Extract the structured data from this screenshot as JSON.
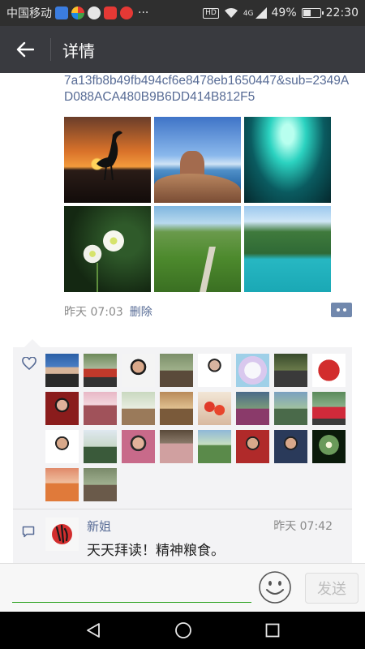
{
  "status_bar": {
    "carrier": "中国移动",
    "more": "···",
    "network": "4G",
    "battery": "49%",
    "battery_level": 0.49,
    "time": "22:30",
    "hd": "HD"
  },
  "app_bar": {
    "title": "详情",
    "back_icon": "arrow-left-icon"
  },
  "post": {
    "link_text": "7a13fb8b49fb494cf6e8478eb1650447&sub=2349AD088ACA480B9B6DD414B812F5",
    "photos": [
      "crane-sunset",
      "rocky-seashore",
      "underwater-cave",
      "white-flowers",
      "green-valley-road",
      "fjord-lake"
    ],
    "time": "昨天 07:03",
    "delete_label": "删除"
  },
  "likes": {
    "icon": "heart-icon",
    "count": 26
  },
  "comment": {
    "icon": "comment-icon",
    "name": "新姐",
    "time": "昨天 07:42",
    "text": "天天拜读！精神粮食。"
  },
  "input_bar": {
    "placeholder": "",
    "send_label": "发送",
    "emoji_icon": "smiley-icon"
  },
  "nav": {
    "back": "nav-back-icon",
    "home": "nav-home-icon",
    "recents": "nav-recents-icon"
  },
  "colors": {
    "link": "#576b95",
    "appbar": "#393a3f",
    "statusbar": "#2f2f2f",
    "accent_green": "#2ea321"
  }
}
